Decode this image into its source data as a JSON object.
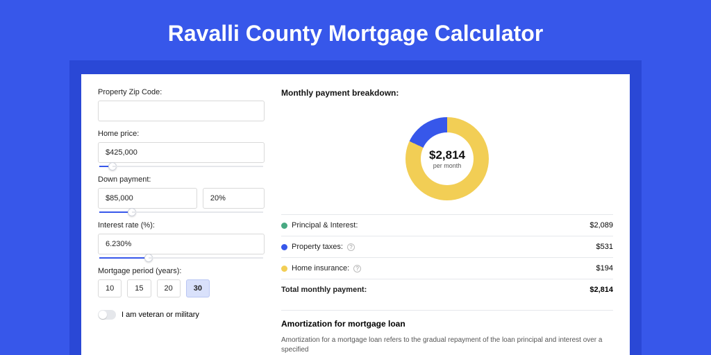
{
  "page": {
    "title": "Ravalli County Mortgage Calculator"
  },
  "form": {
    "zip": {
      "label": "Property Zip Code:",
      "value": ""
    },
    "home_price": {
      "label": "Home price:",
      "value": "$425,000",
      "slider_percent": 8
    },
    "down_payment": {
      "label": "Down payment:",
      "amount": "$85,000",
      "percent": "20%",
      "slider_percent": 20
    },
    "interest_rate": {
      "label": "Interest rate (%):",
      "value": "6.230%",
      "slider_percent": 30
    },
    "period": {
      "label": "Mortgage period (years):",
      "options": [
        "10",
        "15",
        "20",
        "30"
      ],
      "selected": "30"
    },
    "veteran": {
      "label": "I am veteran or military",
      "on": false
    }
  },
  "breakdown": {
    "heading": "Monthly payment breakdown:",
    "center_amount": "$2,814",
    "center_sub": "per month",
    "rows": [
      {
        "color": "green",
        "label": "Principal & Interest:",
        "help": false,
        "value": "$2,089"
      },
      {
        "color": "blue",
        "label": "Property taxes:",
        "help": true,
        "value": "$531"
      },
      {
        "color": "yellow",
        "label": "Home insurance:",
        "help": true,
        "value": "$194"
      }
    ],
    "total_label": "Total monthly payment:",
    "total_value": "$2,814"
  },
  "amort": {
    "heading": "Amortization for mortgage loan",
    "text": "Amortization for a mortgage loan refers to the gradual repayment of the loan principal and interest over a specified"
  },
  "chart_data": {
    "type": "pie",
    "title": "Monthly payment breakdown",
    "unit": "USD per month",
    "total": 2814,
    "series": [
      {
        "name": "Principal & Interest",
        "value": 2089,
        "color": "#48a982"
      },
      {
        "name": "Property taxes",
        "value": 531,
        "color": "#3757ea"
      },
      {
        "name": "Home insurance",
        "value": 194,
        "color": "#f2ce55"
      }
    ]
  }
}
